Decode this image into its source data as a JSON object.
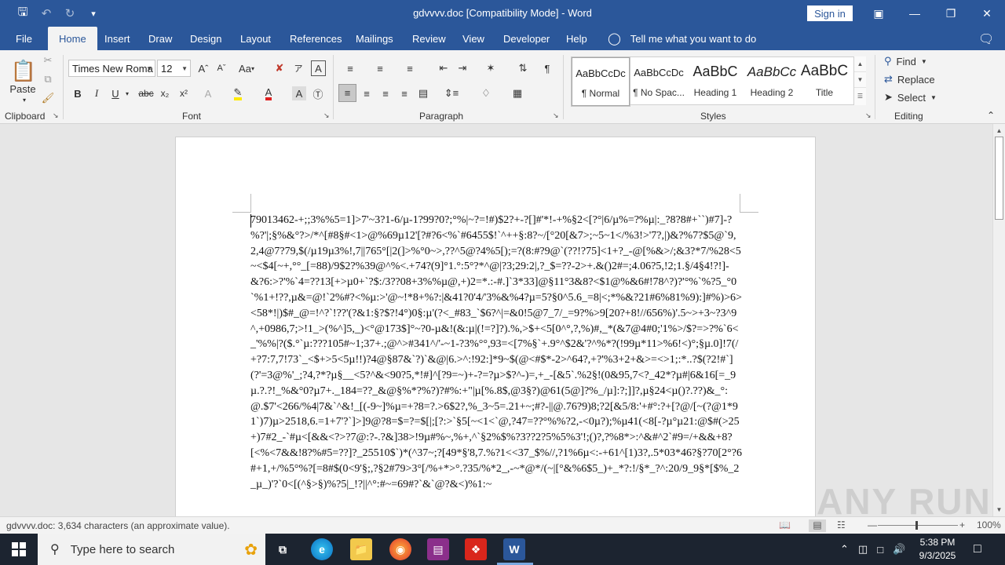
{
  "window": {
    "title": "gdvvvv.doc [Compatibility Mode]  -  Word",
    "sign_in": "Sign in"
  },
  "tabs": [
    {
      "label": "File"
    },
    {
      "label": "Home"
    },
    {
      "label": "Insert"
    },
    {
      "label": "Draw"
    },
    {
      "label": "Design"
    },
    {
      "label": "Layout"
    },
    {
      "label": "References"
    },
    {
      "label": "Mailings"
    },
    {
      "label": "Review"
    },
    {
      "label": "View"
    },
    {
      "label": "Developer"
    },
    {
      "label": "Help"
    }
  ],
  "tell_me": "Tell me what you want to do",
  "ribbon": {
    "clipboard": {
      "paste": "Paste",
      "label": "Clipboard"
    },
    "font": {
      "name": "Times New Roma",
      "size": "12",
      "label": "Font",
      "case_btn": "Aa"
    },
    "paragraph": {
      "label": "Paragraph"
    },
    "styles": {
      "label": "Styles",
      "items": [
        {
          "sample": "AaBbCcDc",
          "name": "¶ Normal"
        },
        {
          "sample": "AaBbCcDc",
          "name": "¶ No Spac..."
        },
        {
          "sample": "AaBbC",
          "name": "Heading 1"
        },
        {
          "sample": "AaBbCc",
          "name": "Heading 2"
        },
        {
          "sample": "AaBbC",
          "name": "Title"
        }
      ]
    },
    "editing": {
      "label": "Editing",
      "find": "Find",
      "replace": "Replace",
      "select": "Select"
    }
  },
  "document": {
    "text": "79013462-+;;3%%5=1]>7'~3?1-6/µ-1?99?0?;°%|~?=!#)$2?+-?[]#'*!-+%§2<[?°|6/µ%=?%µ|:_?8?8#+``)#7]-?%?'|;§%&°?>/*^[#8§#<1>@%69µ12'[?#?6<%`#6455$!`^++§:8?~/[°20[&7>;~5~1</%3!>'7?,|)&?%7?$5@`9,2,4@7?79,$(/µ19µ3%!,7||765°[|2(]>%°0~>,??^5@?4%5[);=?(8:#?9@`(??!?75]<1+?_-@[%&>/;&3?*7/%28<5~<$4[~+,°°_[=88)/9$2?%39@^%<.+74?(9]°1.°:5°?*^@|?3;29:2|,?_$=??-2>+.&()2#=;4.06?5,!2;1.§/4§4!?!]-&?6:>?'%`4=??13[+>µ0+`?$:/3??08+3%%µ@,+)2=*.:-#.]`3*33]@§11°3&8?<$1@%&6#!78^?)?'°%`%?5_°0`%1+!??,µ&=@!`2%#?<%µ:>'@~!*8+%?:|&41?0'4/'3%&%4?µ=5?§0^5.6_=8|<;*%&?21#6%81%9):]#%)>6><58*!|)$#_@=!^?`!??'(?&1:§?$?!4°)0§:µ'(?<_#83_`$6?^|=&0!5@7_7/_=9?%>9[20?+8!//656%)'.5~>+3~?3^9^,+0986,7;>!1_>(%^]5,_)<°@173$]°~?0-µ&!(&:µ|(!=?]?).%,>$+<5[0^°,?,%)#,_*(&7@4#0;'1%>/$?=>?%`6<_'%%|?($.°`µ:???105#~1;37+.;@^>#341^/'-~1-?3%°°,93=<[7%§`+.9°^$2&'?^%*?(!99µ*11>%6!<)°;§µ.0]!7(/+?7:7,7!73`_<$+>5<5µ!!)?4@§87&`?)`&@|6.>^:!92:]*9~$(@<#$*-2>^64?,+?'%3+2+&>=<>1;:*..?$(?2!#`](?'=3@%'_;?4,?*?µ§__<5?^&<90?5,*!#]^[?9=~)+-?=?µ>$?^-)=,+_-[&5`.%2§!(0&95,7<?_42*?µ#|6&16[=_9µ.?.?!_%&°0?µ7+._184=??_&@§%*?%?)?#%:+\"|µ[%.8$,@3§?)@61(5@]?%_/µ]:?;]]?,µ§24<µ()?.??)&_°:@.$7'<266/%4|7&`^&!_[(-9~]%µ=+?8=?.>6$2?,%_3~5=.21+~;#?-||@.76?9)8;?2[&5/8:'+#°:?+[?@/[~(?@1*91`)7)µ>2518,6.=1+7'?`]>]9@?8=$=?=$[|;[?:>`§5[~<1<`@,?47=??°%%?2,-<0µ?);%µ41(<8[-?µ°µ21:@$#(>25+)7#2_-`#µ<[&&<?>?7@:?-.?&]38>!9µ#%~,%+,^`§2%$%?3??2?5%5%3'!;()?,?%8*>:^&#^2`#9=/+&&+8?[<%<7&&!8?%#5=??]?_25510$`)*(^37~;?[49*§'8,7.%?1<<37_$%//,?1%6µ<:-+61^[1)3?,.5*03*46?§?70[2°?6#+1,+/%5°%?[=8#$(0<9'§;,?§2#79>3°[/%+*>°.?35/%*2_,-~*@*/(~|[°&%6$5_)+_*?:!/§*_?^:20/9_9§*[$%_2_µ_)'?`0<[(^§>§)%?5|_!?||^°:#~=69#?`&`@?&<)%1:~"
  },
  "status": {
    "word_count": "gdvvvv.doc: 3,634 characters (an approximate value).",
    "zoom": "100%"
  },
  "taskbar": {
    "search_placeholder": "Type here to search",
    "time": "5:38 PM",
    "date": "9/3/2025"
  },
  "watermark": "ANY RUN"
}
